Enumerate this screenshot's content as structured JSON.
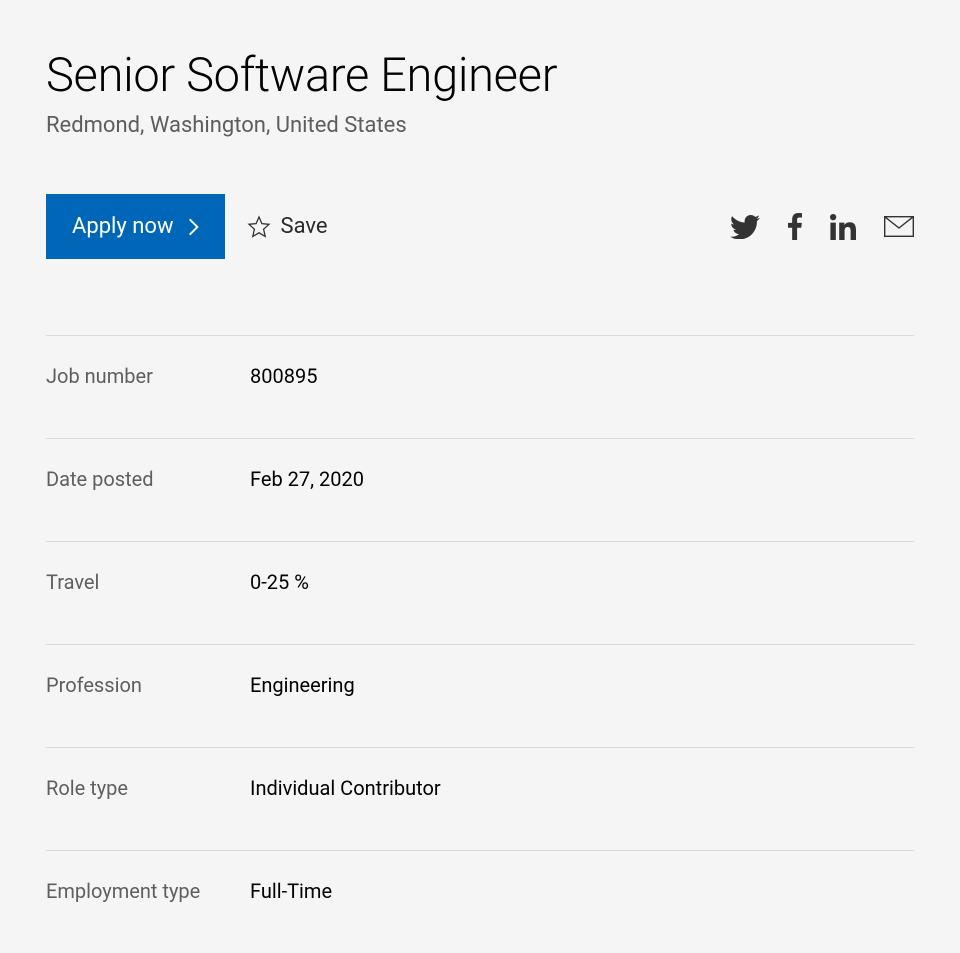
{
  "job": {
    "title": "Senior Software Engineer",
    "location": "Redmond, Washington, United States"
  },
  "actions": {
    "apply_label": "Apply now",
    "save_label": "Save"
  },
  "details": [
    {
      "label": "Job number",
      "value": "800895"
    },
    {
      "label": "Date posted",
      "value": "Feb 27, 2020"
    },
    {
      "label": "Travel",
      "value": "0-25 %"
    },
    {
      "label": "Profession",
      "value": "Engineering"
    },
    {
      "label": "Role type",
      "value": "Individual Contributor"
    },
    {
      "label": "Employment type",
      "value": "Full-Time"
    }
  ]
}
